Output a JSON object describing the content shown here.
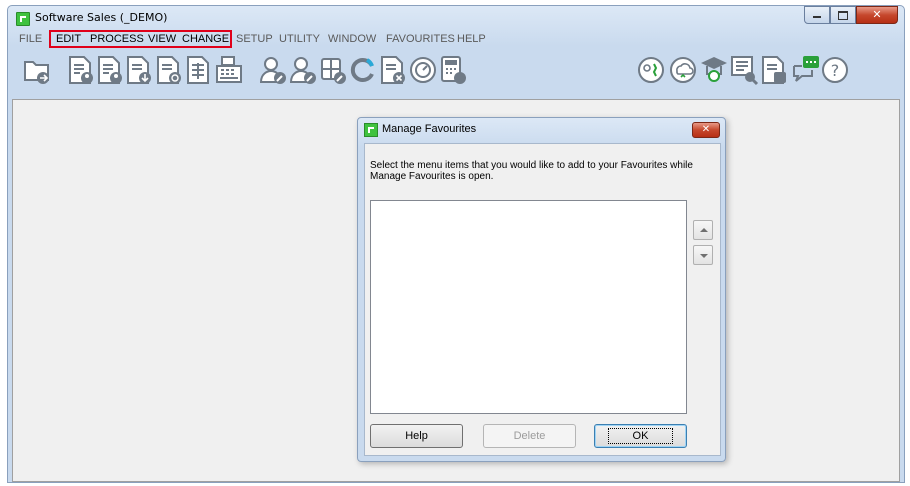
{
  "window": {
    "title": "Software Sales (_DEMO)",
    "close_glyph": "✕"
  },
  "menu": [
    "FILE",
    "EDIT",
    "PROCESS",
    "VIEW",
    "CHANGE",
    "SETUP",
    "UTILITY",
    "WINDOW",
    "FAVOURITES",
    "HELP"
  ],
  "toolbar_icons": [
    "open-folder-icon",
    "document-user-icon",
    "document-user-icon-2",
    "document-download-icon",
    "document-refresh-icon",
    "ledger-icon",
    "cash-register-icon",
    "user-edit-icon",
    "user-edit-icon-2",
    "stamp-pen-icon",
    "refresh-circle-icon",
    "document-delete-icon",
    "dashboard-gauge-icon",
    "calculator-icon",
    "people-icon",
    "cloud-sync-icon",
    "email-graduate-icon",
    "screen-search-icon",
    "document-text-icon",
    "chat-bubble-icon",
    "help-icon"
  ],
  "dialog": {
    "title": "Manage Favourites",
    "message": "Select the menu items that you would like to add to your Favourites while Manage Favourites is open.",
    "help_label": "Help",
    "delete_label": "Delete",
    "ok_label": "OK",
    "close_glyph": "✕"
  },
  "colors": {
    "highlight": "#e0001a",
    "close": "#c6482d",
    "icon": "#6f7a86"
  }
}
